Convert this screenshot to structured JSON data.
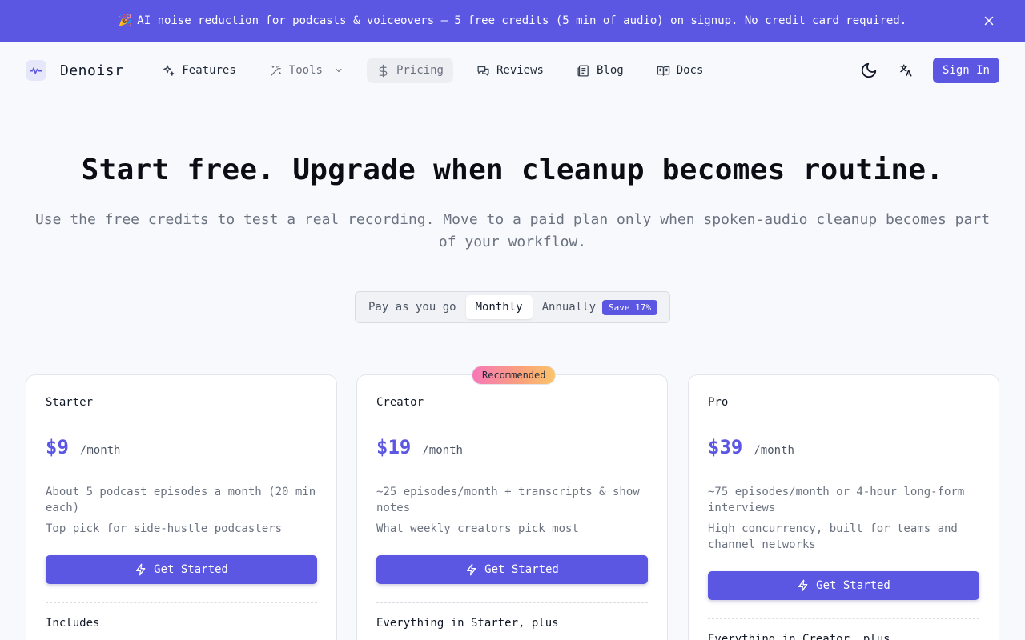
{
  "banner": {
    "emoji": "🎉",
    "text": "AI noise reduction for podcasts & voiceovers — 5 free credits (5 min of audio) on signup. No credit card required."
  },
  "nav": {
    "brand": "Denoisr",
    "items": [
      {
        "label": "Features",
        "icon": "sparkles-icon"
      },
      {
        "label": "Tools",
        "icon": "magic-wand-icon"
      },
      {
        "label": "Pricing",
        "icon": "dollar-icon"
      },
      {
        "label": "Reviews",
        "icon": "chat-icon"
      },
      {
        "label": "Blog",
        "icon": "newspaper-icon"
      },
      {
        "label": "Docs",
        "icon": "book-icon"
      }
    ],
    "sign_in": "Sign In"
  },
  "hero": {
    "title": "Start free. Upgrade when cleanup becomes routine.",
    "subtitle": "Use the free credits to test a real recording. Move to a paid plan only when spoken-audio cleanup becomes part of your workflow."
  },
  "billing": {
    "options": [
      "Pay as you go",
      "Monthly",
      "Annually"
    ],
    "selected": "Monthly",
    "save_badge": "Save 17%"
  },
  "recommended_badge": "Recommended",
  "plans": [
    {
      "name": "Starter",
      "price": "$9",
      "period": "/month",
      "desc1": "About 5 podcast episodes a month (20 min each)",
      "desc2": "Top pick for side-hustle podcasters",
      "cta": "Get Started",
      "includes": "Includes"
    },
    {
      "name": "Creator",
      "price": "$19",
      "period": "/month",
      "desc1": "~25 episodes/month + transcripts & show notes",
      "desc2": "What weekly creators pick most",
      "cta": "Get Started",
      "includes": "Everything in Starter, plus"
    },
    {
      "name": "Pro",
      "price": "$39",
      "period": "/month",
      "desc1": "~75 episodes/month or 4-hour long-form interviews",
      "desc2": "High concurrency, built for teams and channel networks",
      "cta": "Get Started",
      "includes": "Everything in Creator, plus"
    }
  ],
  "colors": {
    "accent": "#5b57e2",
    "background": "#f8f9fc"
  }
}
